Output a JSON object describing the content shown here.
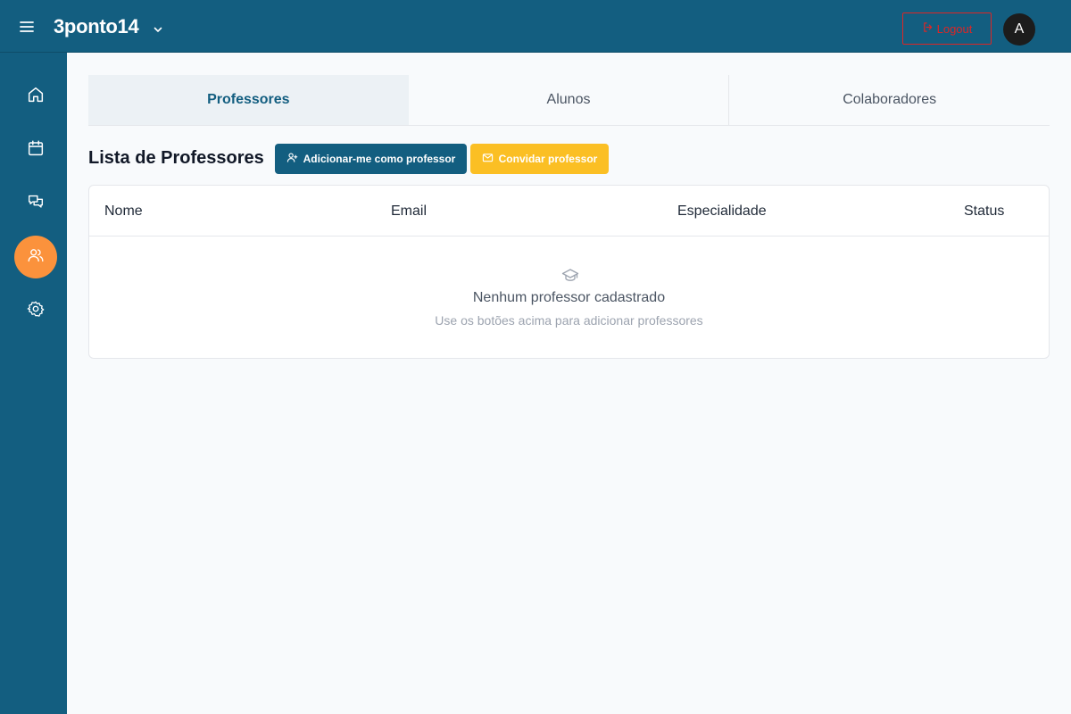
{
  "header": {
    "brand": "3ponto14",
    "logout_label": "Logout",
    "avatar_initial": "A"
  },
  "sidebar": {
    "items": [
      {
        "name": "home",
        "icon": "home-icon",
        "active": false
      },
      {
        "name": "calendar",
        "icon": "calendar-icon",
        "active": false
      },
      {
        "name": "messages",
        "icon": "chat-icon",
        "active": false
      },
      {
        "name": "users",
        "icon": "users-icon",
        "active": true
      },
      {
        "name": "settings",
        "icon": "gear-icon",
        "active": false
      }
    ]
  },
  "tabs": [
    {
      "label": "Professores",
      "active": true
    },
    {
      "label": "Alunos",
      "active": false
    },
    {
      "label": "Colaboradores",
      "active": false
    }
  ],
  "section": {
    "title": "Lista de Professores",
    "add_self_label": "Adicionar-me como professor",
    "invite_label": "Convidar professor"
  },
  "table": {
    "columns": [
      "Nome",
      "Email",
      "Especialidade",
      "Status"
    ],
    "rows": [],
    "empty_title": "Nenhum professor cadastrado",
    "empty_subtitle": "Use os botões acima para adicionar professores"
  },
  "colors": {
    "primary": "#135e80",
    "accent": "#fb923c",
    "warning": "#fbbf24",
    "danger": "#dc2626"
  }
}
